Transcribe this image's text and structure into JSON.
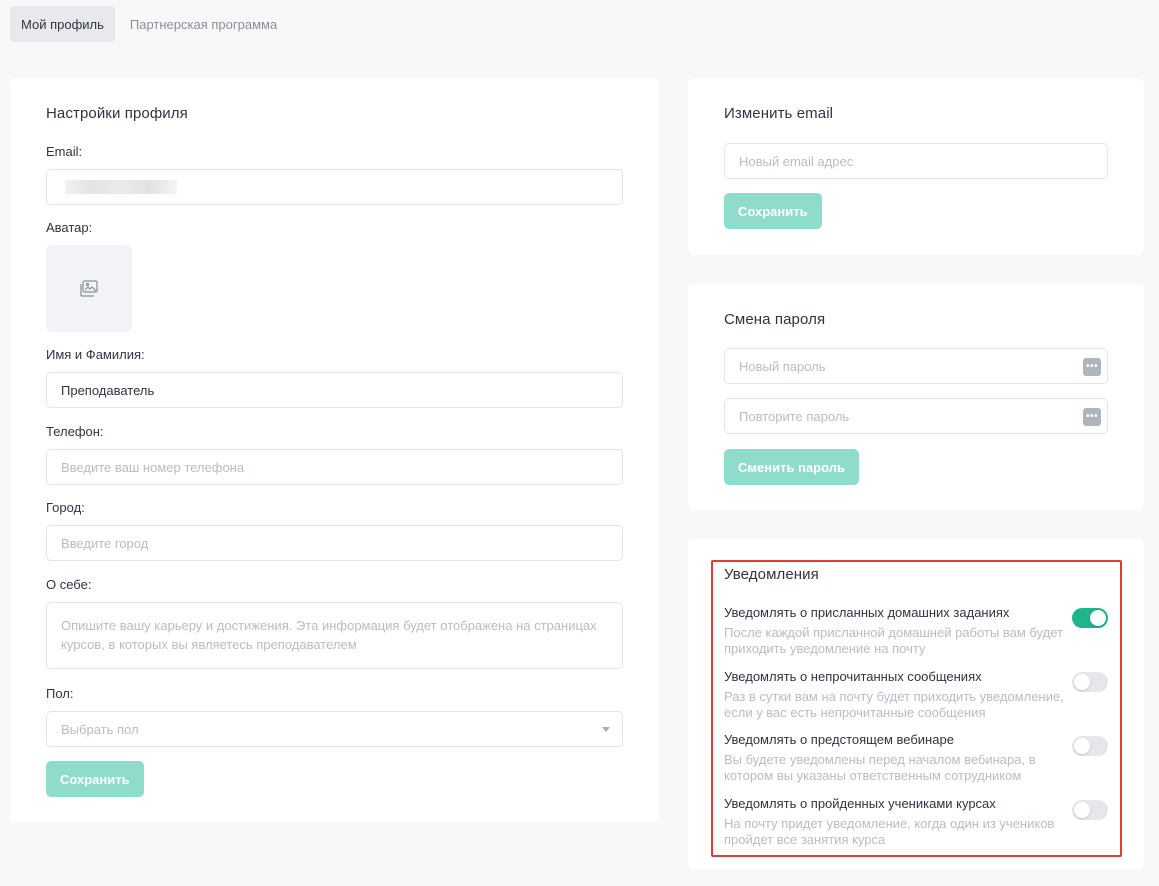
{
  "tabs": [
    {
      "label": "Мой профиль",
      "active": true
    },
    {
      "label": "Партнерская программа",
      "active": false
    }
  ],
  "profile": {
    "title": "Настройки профиля",
    "email_label": "Email:",
    "avatar_label": "Аватар:",
    "name_label": "Имя и Фамилия:",
    "name_value": "Преподаватель",
    "phone_label": "Телефон:",
    "phone_placeholder": "Введите ваш номер телефона",
    "city_label": "Город:",
    "city_placeholder": "Введите город",
    "about_label": "О себе:",
    "about_placeholder": "Опишите вашу карьеру и достижения. Эта информация будет отображена на страницах курсов, в которых вы являетесь преподавателем",
    "gender_label": "Пол:",
    "gender_placeholder": "Выбрать пол",
    "save_label": "Сохранить"
  },
  "change_email": {
    "title": "Изменить email",
    "placeholder": "Новый email адрес",
    "save_label": "Сохранить"
  },
  "change_password": {
    "title": "Смена пароля",
    "new_placeholder": "Новый пароль",
    "repeat_placeholder": "Повторите пароль",
    "submit_label": "Сменить пароль"
  },
  "notifications": {
    "title": "Уведомления",
    "items": [
      {
        "title": "Уведомлять о присланных домашних заданиях",
        "desc": "После каждой присланной домашней работы вам будет приходить уведомление на почту",
        "enabled": true
      },
      {
        "title": "Уведомлять о непрочитанных сообщениях",
        "desc": "Раз в сутки вам на почту будет приходить уведомление, если у вас есть непрочитанные сообщения",
        "enabled": false
      },
      {
        "title": "Уведомлять о предстоящем вебинаре",
        "desc": "Вы будете уведомлены перед началом вебинара, в котором вы указаны ответственным сотрудником",
        "enabled": false
      },
      {
        "title": "Уведомлять о пройденных учениками курсах",
        "desc": "На почту придет уведомление, когда один из учеников пройдет все занятия курса",
        "enabled": false
      }
    ]
  },
  "colors": {
    "accent": "#1fb48b",
    "button": "#8fdcca",
    "highlight": "#e03b3b"
  }
}
